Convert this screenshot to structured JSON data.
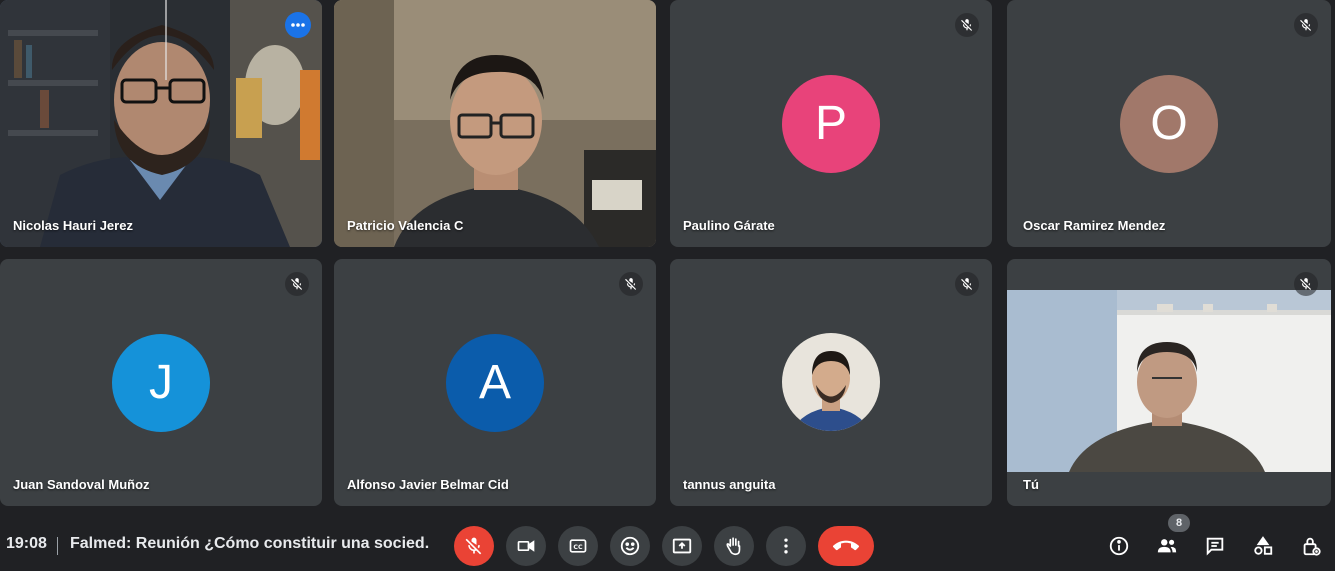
{
  "participants": [
    {
      "name": "Nicolas Hauri Jerez",
      "type": "video",
      "speaking": true
    },
    {
      "name": "Patricio Valencia C",
      "type": "video"
    },
    {
      "name": "Paulino Gárate",
      "type": "avatar",
      "initial": "P",
      "color": "#e8437a",
      "muted": true
    },
    {
      "name": "Oscar Ramirez Mendez",
      "type": "avatar",
      "initial": "O",
      "color": "#a1786a",
      "muted": true
    },
    {
      "name": "Juan Sandoval Muñoz",
      "type": "avatar",
      "initial": "J",
      "color": "#1592d9",
      "muted": true
    },
    {
      "name": "Alfonso Javier Belmar Cid",
      "type": "avatar",
      "initial": "A",
      "color": "#0b5cab",
      "muted": true
    },
    {
      "name": "tannus anguita",
      "type": "photo",
      "muted": true
    },
    {
      "name": "Tú",
      "type": "video",
      "muted": true
    }
  ],
  "bar": {
    "time": "19:08",
    "title": "Falmed: Reunión ¿Cómo constituir una socied...",
    "people_count": "8"
  },
  "colors": {
    "background": "#202124",
    "tile": "#3c4043",
    "danger": "#ea4335",
    "accent": "#1a73e8"
  }
}
